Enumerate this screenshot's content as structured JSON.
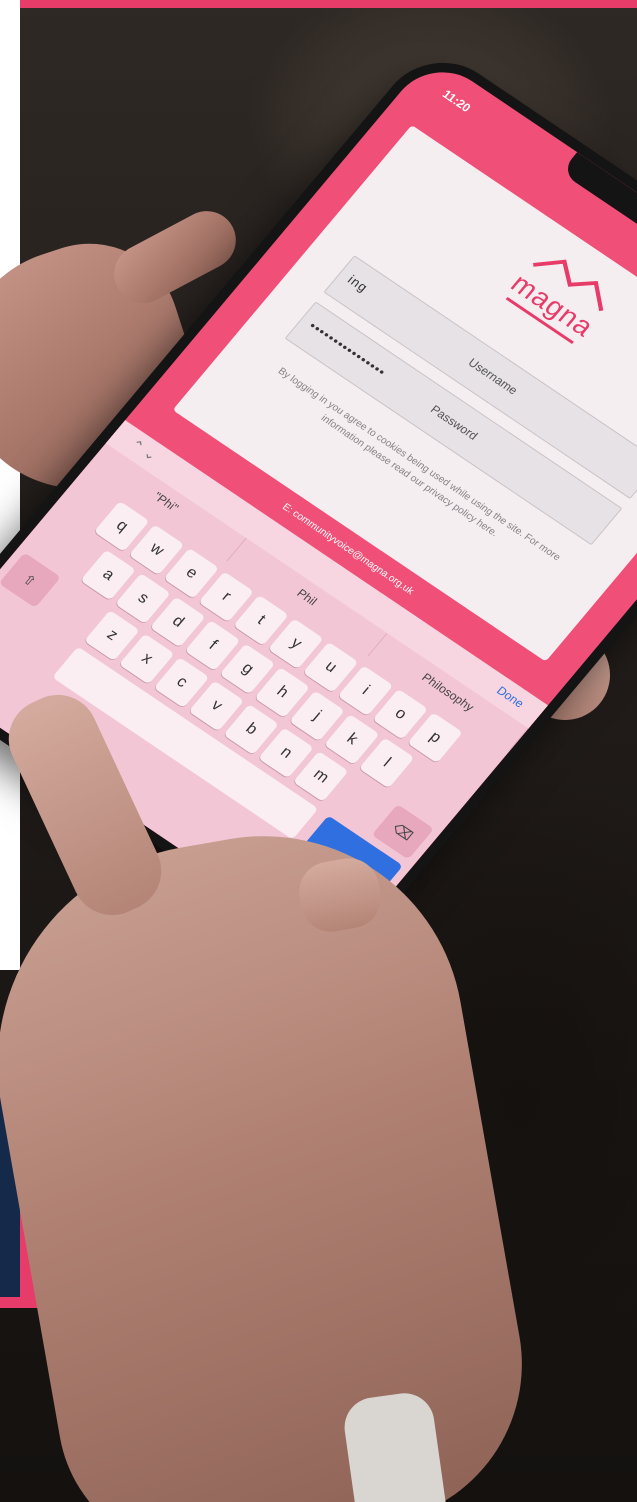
{
  "colors": {
    "accent_pink": "#e73c6a",
    "navy": "#152a4a",
    "phone_screen": "#f05077",
    "done_blue": "#2f6fe0"
  },
  "phone": {
    "status_time": "11:20",
    "logo_text": "magna",
    "username": {
      "label": "Username",
      "value": "ing"
    },
    "password": {
      "label": "Password",
      "value": "••••••••••••••••"
    },
    "disclaimer": "By logging in you agree to cookies being used while using the site. For more information please read our privacy policy here.",
    "email_link": "E: communityvoice@magna.org.uk",
    "keyboard": {
      "done_label": "Done",
      "suggestions": [
        "\"Phi\"",
        "Phil",
        "Philosophy"
      ],
      "row1": [
        "q",
        "w",
        "e",
        "r",
        "t",
        "y",
        "u",
        "i",
        "o",
        "p"
      ],
      "row2": [
        "a",
        "s",
        "d",
        "f",
        "g",
        "h",
        "j",
        "k",
        "l"
      ],
      "row3": [
        "z",
        "x",
        "c",
        "v",
        "b",
        "n",
        "m"
      ],
      "backspace_icon": "backspace-icon",
      "shift_icon": "shift-icon"
    }
  }
}
